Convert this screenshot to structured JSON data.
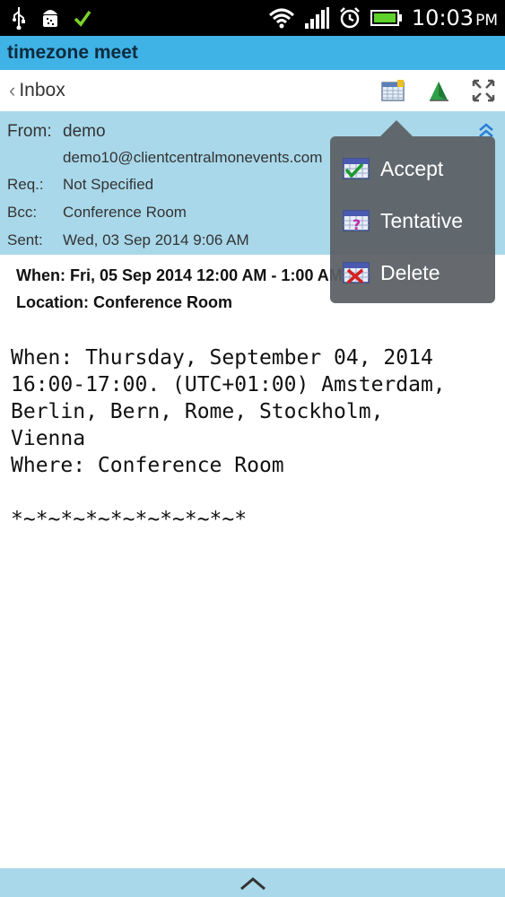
{
  "status_bar": {
    "time": "10:03",
    "ampm": "PM",
    "icons": [
      "usb-icon",
      "android-debug-icon",
      "check-icon",
      "wifi-icon",
      "signal-icon",
      "alarm-icon",
      "battery-icon"
    ]
  },
  "title_bar": {
    "title": "timezone meet"
  },
  "nav": {
    "back_label": "Inbox",
    "icons": [
      "calendar-icon",
      "flag-icon",
      "fullscreen-icon"
    ]
  },
  "header": {
    "from_label": "From:",
    "from_name": "demo",
    "from_email": "demo10@clientcentralmonevents.com",
    "req_label": "Req.:",
    "req_value": "Not Specified",
    "bcc_label": "Bcc:",
    "bcc_value": "Conference Room",
    "sent_label": "Sent:",
    "sent_value": "Wed, 03 Sep 2014 9:06 AM"
  },
  "summary": {
    "when": "When: Fri, 05 Sep 2014 12:00 AM - 1:00 AM",
    "location": "Location: Conference Room"
  },
  "body": {
    "text": "When: Thursday, September 04, 2014\n16:00-17:00. (UTC+01:00) Amsterdam,\nBerlin, Bern, Rome, Stockholm,\nVienna\nWhere: Conference Room\n\n*~*~*~*~*~*~*~*~*~*"
  },
  "popup_menu": {
    "items": [
      {
        "label": "Accept",
        "icon": "calendar-accept-icon"
      },
      {
        "label": "Tentative",
        "icon": "calendar-tentative-icon"
      },
      {
        "label": "Delete",
        "icon": "calendar-delete-icon"
      }
    ]
  },
  "colors": {
    "title_bar": "#3fb2e6",
    "header_bg": "#a9d8ea",
    "popup_bg": "#5a5f64"
  }
}
